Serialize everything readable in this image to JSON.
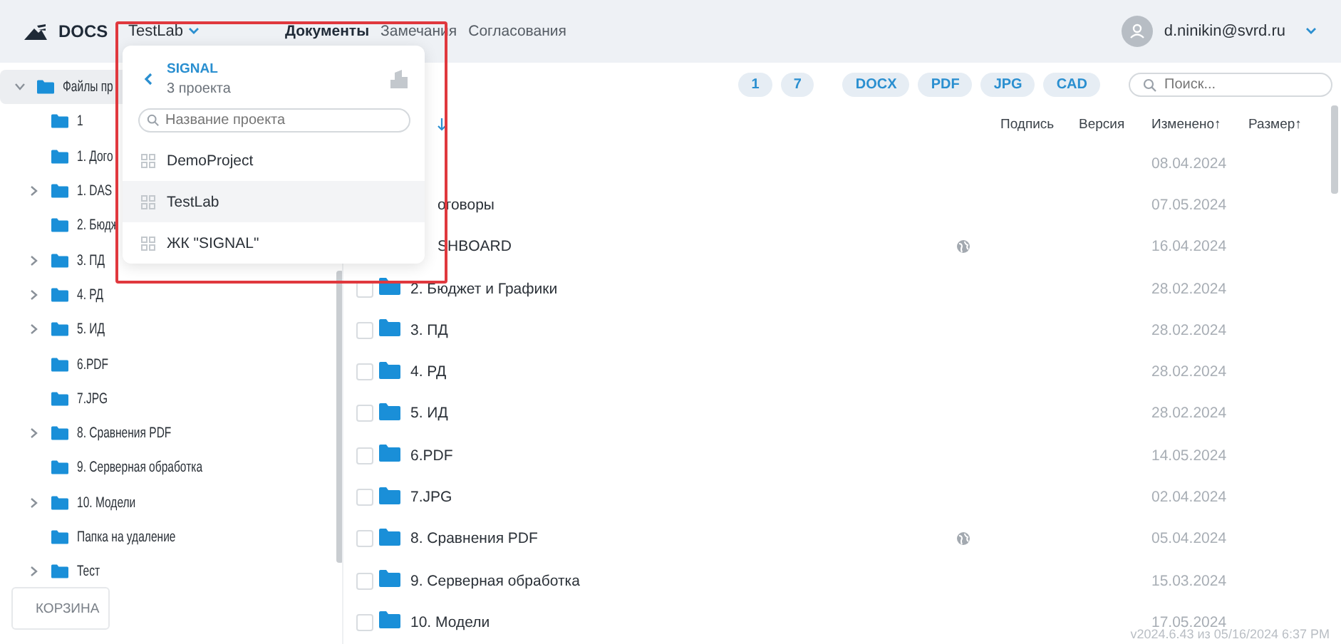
{
  "header": {
    "logo": "DOCS",
    "project": "TestLab",
    "tabs": [
      {
        "label": "Документы",
        "selected": true
      },
      {
        "label": "Замечания",
        "selected": false
      },
      {
        "label": "Согласования",
        "selected": false
      }
    ],
    "user": "d.ninikin@svrd.ru"
  },
  "sidebar": {
    "items": [
      {
        "label": "Файлы пр",
        "expanded": true,
        "selected": true,
        "children": [
          {
            "label": "1",
            "selected": false
          },
          {
            "label": "1. Дого",
            "selected": false
          },
          {
            "label": "1. DAS",
            "expanded": false,
            "selected": false
          },
          {
            "label": "2. Бюдж",
            "selected": false
          },
          {
            "label": "3. ПД",
            "expanded": false,
            "selected": false
          },
          {
            "label": "4. РД",
            "expanded": false,
            "selected": false
          },
          {
            "label": "5. ИД",
            "expanded": false,
            "selected": false
          },
          {
            "label": "6.PDF",
            "selected": false
          },
          {
            "label": "7.JPG",
            "selected": false
          },
          {
            "label": "8. Сравнения PDF",
            "expanded": false,
            "selected": false
          },
          {
            "label": "9. Серверная обработка",
            "selected": false
          },
          {
            "label": "10. Модели",
            "expanded": false,
            "selected": false
          },
          {
            "label": "Папка на удаление",
            "selected": false
          },
          {
            "label": "Тест",
            "expanded": false,
            "selected": false
          }
        ]
      }
    ],
    "trash_button": "КОРЗИНА"
  },
  "toolbar": {
    "counts": [
      "1",
      "7"
    ],
    "types": [
      "DOCX",
      "PDF",
      "JPG",
      "CAD"
    ],
    "search": {
      "placeholder": "Поиск..."
    }
  },
  "table": {
    "columns": [
      "Подпись",
      "Версия",
      "Изменено↑",
      "Размер↑"
    ],
    "rows": [
      {
        "date": "08.04.2024",
        "public": false
      },
      {
        "covered": true,
        "name": "оговоры",
        "date": "07.05.2024",
        "public": false
      },
      {
        "covered": true,
        "name": "SHBOARD",
        "date": "16.04.2024",
        "public": true
      },
      {
        "covered": false,
        "checked": false,
        "name": "2. Бюджет и Графики",
        "date": "28.02.2024",
        "public": false
      },
      {
        "covered": false,
        "checked": false,
        "name": "3. ПД",
        "date": "28.02.2024",
        "public": false
      },
      {
        "covered": false,
        "checked": false,
        "name": "4. РД",
        "date": "28.02.2024",
        "public": false
      },
      {
        "covered": false,
        "checked": false,
        "name": "5. ИД",
        "date": "28.02.2024",
        "public": false
      },
      {
        "covered": false,
        "checked": false,
        "name": "6.PDF",
        "date": "14.05.2024",
        "public": false
      },
      {
        "covered": false,
        "checked": false,
        "name": "7.JPG",
        "date": "02.04.2024",
        "public": false
      },
      {
        "covered": false,
        "checked": false,
        "name": "8. Сравнения PDF",
        "date": "05.04.2024",
        "public": true
      },
      {
        "covered": false,
        "checked": false,
        "name": "9. Серверная обработка",
        "date": "15.03.2024",
        "public": false
      },
      {
        "covered": false,
        "checked": false,
        "name": "10. Модели",
        "date": "17.05.2024",
        "public": false
      }
    ]
  },
  "dropdown": {
    "title": "SIGNAL",
    "subtitle": "3 проекта",
    "search": {
      "placeholder": "Название проекта"
    },
    "projects": [
      {
        "label": "DemoProject",
        "selected": false
      },
      {
        "label": "TestLab",
        "selected": true
      },
      {
        "label": "ЖК \"SIGNAL\"",
        "selected": false
      }
    ]
  },
  "version": "v2024.6.43 из 05/16/2024 6:37 PM"
}
